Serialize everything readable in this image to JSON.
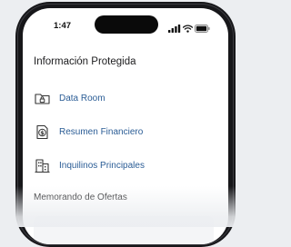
{
  "status_bar": {
    "time": "1:47"
  },
  "protected_info": {
    "title": "Información Protegida",
    "items": [
      {
        "label": "Data Room",
        "icon": "folder-lock-icon"
      },
      {
        "label": "Resumen Financiero",
        "icon": "dollar-document-icon"
      },
      {
        "label": "Inquilinos Principales",
        "icon": "building-icon"
      }
    ]
  },
  "offering_memo": {
    "title": "Memorando de Ofertas"
  },
  "colors": {
    "link": "#2a5c95",
    "text": "#1c1c1e",
    "frame": "#17171a"
  }
}
